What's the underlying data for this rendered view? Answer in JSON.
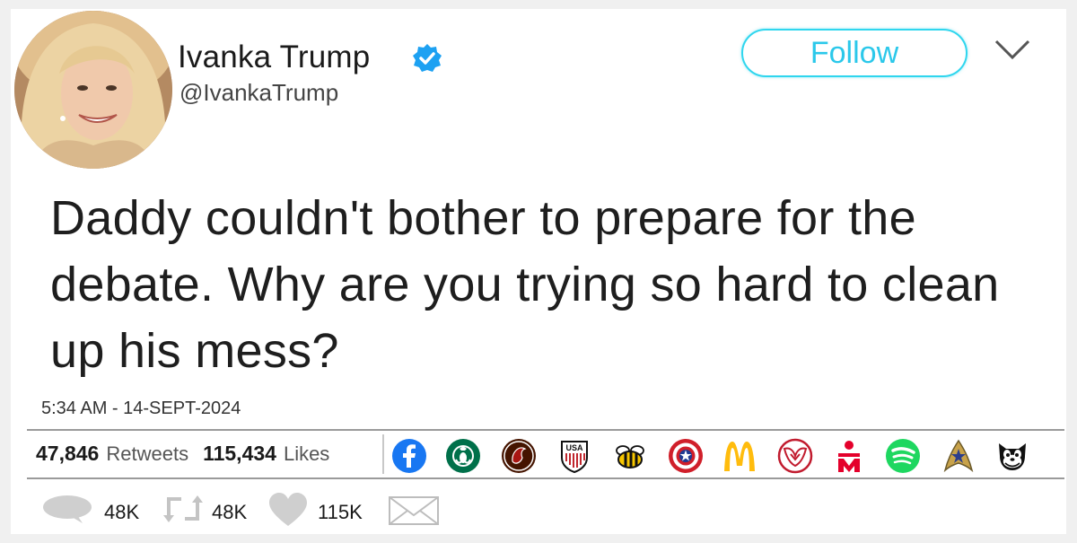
{
  "user": {
    "name": "Ivanka Trump",
    "handle": "@IvankaTrump",
    "verified": true
  },
  "header": {
    "follow_label": "Follow",
    "accent_color": "#2bc8ea"
  },
  "tweet": {
    "text": "Daddy couldn't bother to prepare for the debate. Why are you trying so hard to clean up his mess?",
    "timestamp": "5:34 AM - 14-SEPT-2024"
  },
  "stats": {
    "retweets_count": "47,846",
    "retweets_label": "Retweets",
    "likes_count": "115,434",
    "likes_label": "Likes"
  },
  "liker_avatars": [
    "facebook-icon",
    "starbucks-icon",
    "chipotle-icon",
    "usa-soccer-icon",
    "bee-icon",
    "captain-america-icon",
    "mcdonalds-icon",
    "owl-shield-icon",
    "ironman-triathlon-icon",
    "spotify-icon",
    "starfleet-icon",
    "felix-cat-icon"
  ],
  "actions": {
    "reply_count": "48K",
    "retweet_count": "48K",
    "like_count": "115K"
  }
}
